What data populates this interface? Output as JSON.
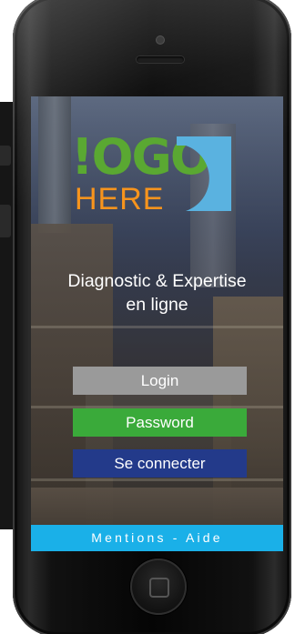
{
  "logo": {
    "word": "!OGO",
    "sub": "HERE",
    "word_color": "#5aa832",
    "sub_color": "#f7941d",
    "shape_color": "#5ab2e0"
  },
  "title": {
    "line1": "Diagnostic & Expertise",
    "line2": "en ligne"
  },
  "form": {
    "login_placeholder": "Login",
    "password_placeholder": "Password",
    "connect_label": "Se connecter"
  },
  "footer": {
    "mentions": "Mentions",
    "separator": " - ",
    "aide": "Aide",
    "bar_color": "#1ab0e8"
  },
  "colors": {
    "login_field": "#9a9a9a",
    "password_field": "#3aaa3a",
    "connect_button": "#233a8a"
  },
  "icons": {
    "home": "home-button-icon",
    "camera": "camera-icon",
    "speaker": "speaker-icon"
  }
}
